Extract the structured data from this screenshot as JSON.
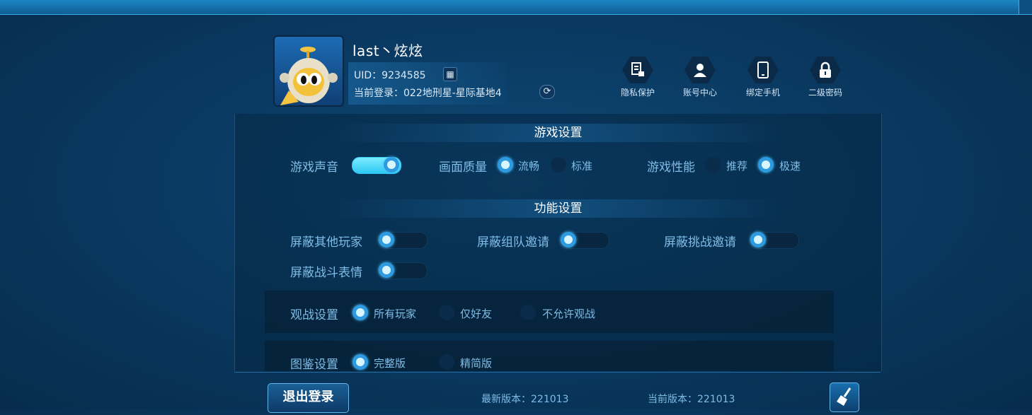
{
  "profile": {
    "username": "last丶炫炫",
    "uid_label": "UID：",
    "uid": "9234585",
    "server_label": "当前登录：",
    "server": "022地刑星-星际基地4"
  },
  "account_actions": [
    {
      "label": "隐私保护",
      "icon": "privacy-doc-lock-icon"
    },
    {
      "label": "账号中心",
      "icon": "user-icon"
    },
    {
      "label": "绑定手机",
      "icon": "phone-icon"
    },
    {
      "label": "二级密码",
      "icon": "lock-icon"
    }
  ],
  "game_settings": {
    "title": "游戏设置",
    "sound": {
      "label": "游戏声音",
      "on": true
    },
    "quality": {
      "label": "画面质量",
      "options": [
        "流畅",
        "标准"
      ],
      "selected": "流畅"
    },
    "performance": {
      "label": "游戏性能",
      "options": [
        "推荐",
        "极速"
      ],
      "selected": "极速"
    }
  },
  "function_settings": {
    "title": "功能设置",
    "toggles": [
      {
        "label": "屏蔽其他玩家",
        "on": false
      },
      {
        "label": "屏蔽组队邀请",
        "on": false
      },
      {
        "label": "屏蔽挑战邀请",
        "on": false
      },
      {
        "label": "屏蔽战斗表情",
        "on": false
      }
    ],
    "spectate": {
      "label": "观战设置",
      "options": [
        "所有玩家",
        "仅好友",
        "不允许观战"
      ],
      "selected": "所有玩家"
    },
    "illustration": {
      "label": "图鉴设置",
      "options": [
        "完整版",
        "精简版"
      ],
      "selected": "完整版"
    }
  },
  "footer": {
    "logout": "退出登录",
    "latest_version_label": "最新版本：",
    "latest_version": "221013",
    "current_version_label": "当前版本：",
    "current_version": "221013",
    "clean_icon": "broom-icon"
  },
  "colors": {
    "accent": "#2e9be0",
    "toggle_on": "#5fdcf8",
    "background": "#0a3a62"
  }
}
